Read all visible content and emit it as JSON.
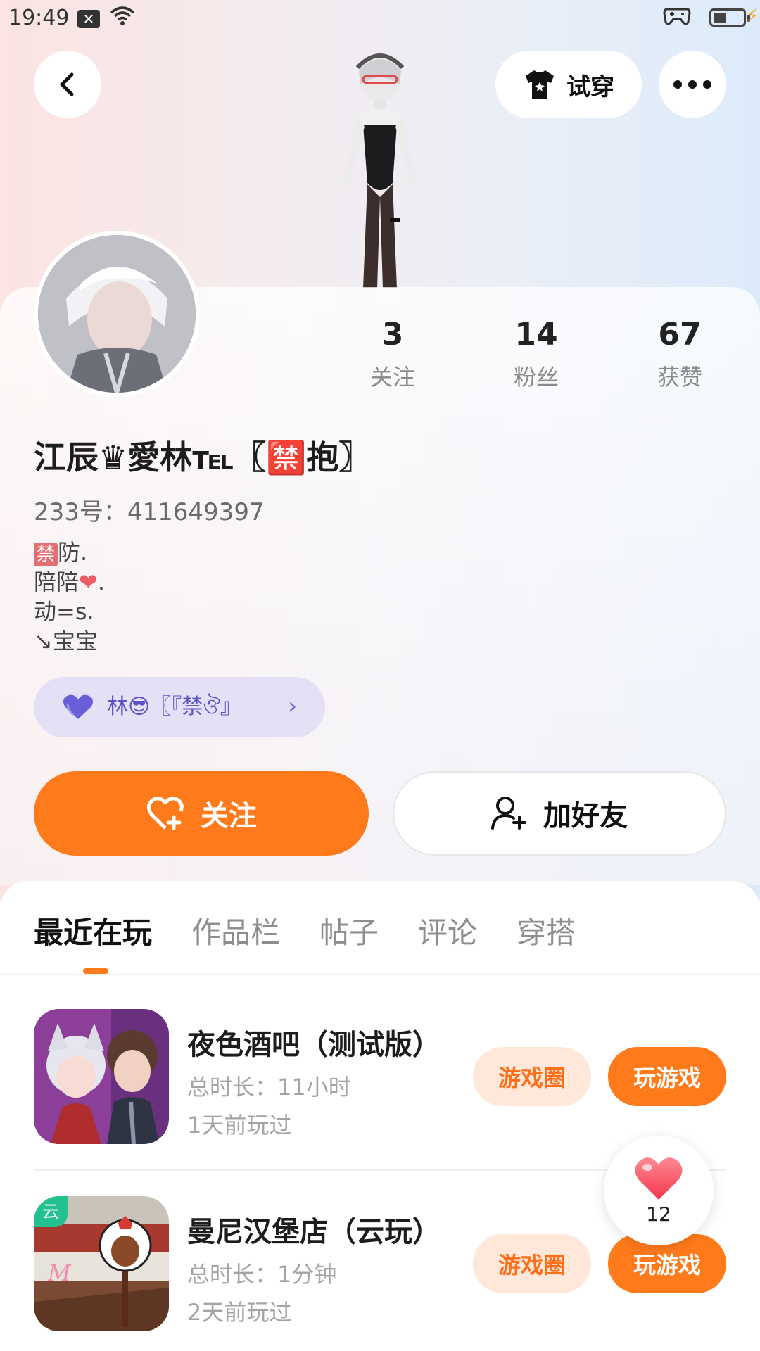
{
  "status_bar": {
    "time": "19:49"
  },
  "header": {
    "try_on_label": "试穿"
  },
  "profile": {
    "stats": [
      {
        "value": "3",
        "label": "关注"
      },
      {
        "value": "14",
        "label": "粉丝"
      },
      {
        "value": "67",
        "label": "获赞"
      }
    ],
    "name": "江辰♛愛林℡〖🈲抱〗",
    "uid": "233号：411649397",
    "bio_lines": [
      "防.",
      "陪陪",
      "动=s.",
      "↘宝宝"
    ],
    "bio_ban_char": "禁",
    "tag": "林😎〖『禁ঔ』"
  },
  "actions": {
    "follow_label": "关注",
    "add_friend_label": "加好友"
  },
  "tabs": [
    {
      "label": "最近在玩",
      "active": true
    },
    {
      "label": "作品栏",
      "active": false
    },
    {
      "label": "帖子",
      "active": false
    },
    {
      "label": "评论",
      "active": false
    },
    {
      "label": "穿搭",
      "active": false
    }
  ],
  "games": [
    {
      "title": "夜色酒吧（测试版）",
      "duration": "总时长：11小时",
      "last_played": "1天前玩过",
      "circle_label": "游戏圈",
      "play_label": "玩游戏"
    },
    {
      "title": "曼尼汉堡店（云玩）",
      "duration": "总时长：1分钟",
      "last_played": "2天前玩过",
      "circle_label": "游戏圈",
      "play_label": "玩游戏",
      "badge": "云"
    }
  ],
  "like_button": {
    "count": "12"
  },
  "colors": {
    "accent": "#ff7a1a",
    "accent_soft": "#ffe8da",
    "tag_bg": "#e4e0f6",
    "tag_text": "#5a52c8"
  },
  "icons": [
    "back-arrow-icon",
    "shirt-icon",
    "more-dots-icon",
    "heart-plus-icon",
    "add-person-icon",
    "chevron-right-icon",
    "purple-heart-icon",
    "like-heart-icon",
    "wifi-icon",
    "gamepad-icon",
    "battery-icon"
  ]
}
